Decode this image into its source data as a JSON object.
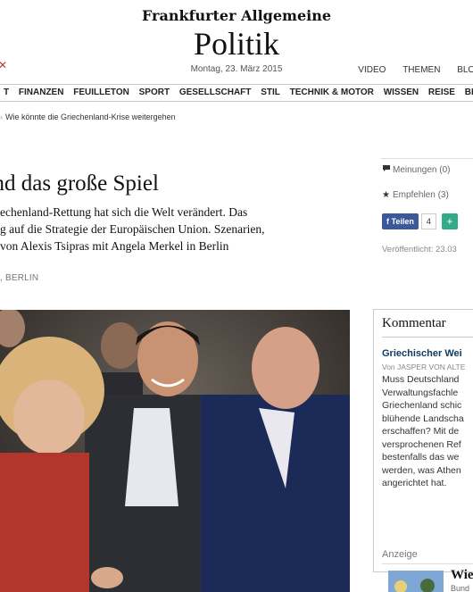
{
  "header": {
    "brand": "Frankfurter Allgemeine",
    "section": "Politik",
    "date": "Montag, 23. März 2015",
    "links": [
      "VIDEO",
      "THEMEN",
      "BLOG"
    ]
  },
  "nav": {
    "items": [
      "T",
      "FINANZEN",
      "FEUILLETON",
      "SPORT",
      "GESELLSCHAFT",
      "STIL",
      "TECHNIK & MOTOR",
      "WISSEN",
      "REISE",
      "BERUF"
    ]
  },
  "breadcrumb": "Wie könnte die Griechenland-Krise weitergehen",
  "article": {
    "headline": "und das große Spiel",
    "lead": [
      "echenland-Rettung hat sich die Welt verändert. Das",
      "g auf die Strategie der Europäischen Union. Szenarien,",
      "von Alexis Tsipras mit Angela Merkel in Berlin"
    ],
    "author": ", BERLIN"
  },
  "sidebar": {
    "comments_label": "Meinungen",
    "comments_count": "(0)",
    "recommend_label": "Empfehlen",
    "recommend_count": "(3)",
    "share_label": "Teilen",
    "share_count": "4",
    "published": "Veröffentlicht: 23.03"
  },
  "kommentar": {
    "header": "Kommentar",
    "title": "Griechischer Wei",
    "author": "Von JASPER VON ALTE",
    "lines": [
      "Muss Deutschland",
      "Verwaltungsfachle",
      "Griechenland schic",
      "blühende Landscha",
      "erschaffen? Mit de",
      "versprochenen Ref",
      "bestenfalls das we",
      "werden, was Athen",
      "angerichtet hat."
    ]
  },
  "ad": {
    "label": "Anzeige",
    "title": "Wie",
    "sub": "Bund"
  },
  "colors": {
    "brand_accent": "#c0392b",
    "link_blue": "#0e3a62",
    "facebook": "#3b5998"
  },
  "icons": [
    "logo-mark-icon",
    "comment-icon",
    "star-icon",
    "facebook-icon",
    "plus-icon",
    "breadcrumb-arrow-icon"
  ]
}
